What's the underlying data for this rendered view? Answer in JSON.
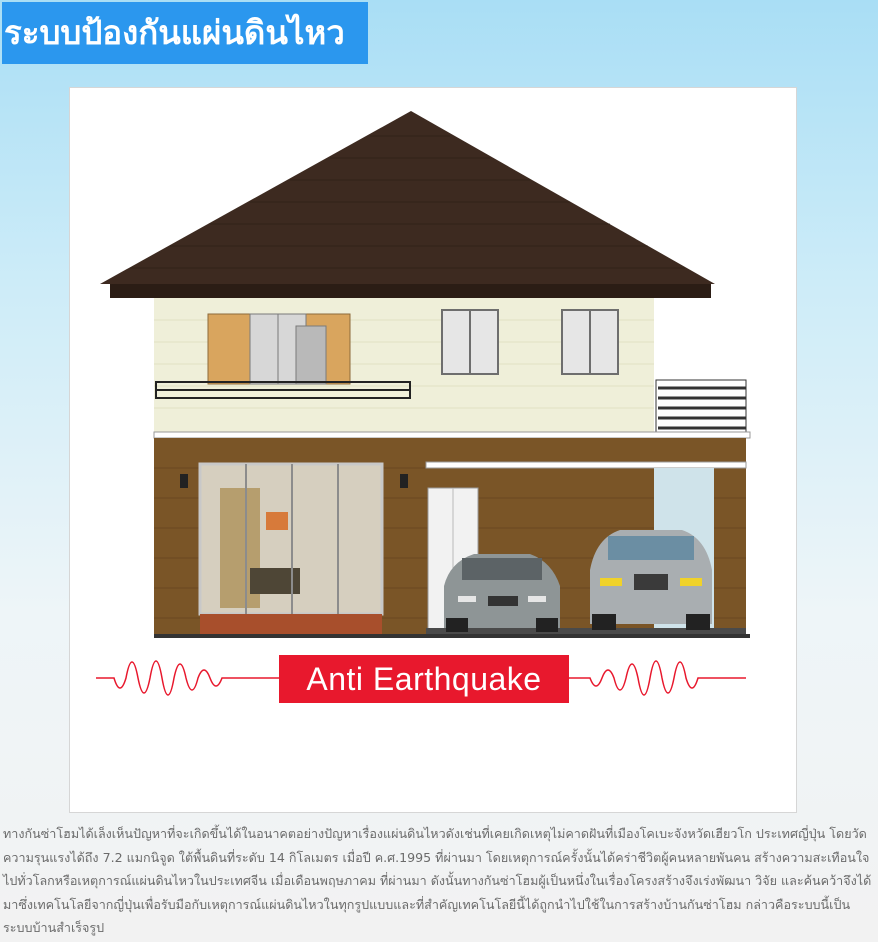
{
  "header": {
    "title": "ระบบป้องกันแผ่นดินไหว",
    "title_bg": "#2b97ee"
  },
  "hero": {
    "badge_label": "Anti Earthquake",
    "badge_color": "#e8182d",
    "wave_color": "#e8182d",
    "roof_color": "#3d2a20",
    "upper_wall_color": "#efefd9",
    "lower_wall_color": "#7a5527"
  },
  "article": {
    "body": "ทางกันซ่าโฮมได้เล็งเห็นปัญหาที่จะเกิดขึ้นได้ในอนาคตอย่างปัญหาเรื่องแผ่นดินไหวดังเช่นที่เคยเกิดเหตุไม่คาดฝันที่เมืองโคเบะจังหวัดเฮียวโก ประเทศญี่ปุ่น โดยวัดความรุนแรงได้ถึง 7.2 แมกนิจูด ใต้พื้นดินที่ระดับ 14 กิโลเมตร เมื่อปี ค.ศ.1995 ที่ผ่านมา โดยเหตุการณ์ครั้งนั้นได้คร่าชีวิตผู้คนหลายพันคน สร้างความสะเทือนใจไปทั่วโลกหรือเหตุการณ์แผ่นดินไหวในประเทศจีน เมื่อเดือนพฤษภาคม ที่ผ่านมา ดังนั้นทางกันซ่าโฮมผู้เป็นหนึ่งในเรื่องโครงสร้างจึงเร่งพัฒนา วิจัย และค้นคว้าจึงได้มาซึ่งเทคโนโลยีจากญี่ปุ่นเพื่อรับมือกับเหตุการณ์แผ่นดินไหวในทุกรูปแบบและที่สำคัญเทคโนโลยีนี้ได้ถูกนำไปใช้ในการสร้างบ้านกันซ่าโฮม กล่าวคือระบบนี้เป็นระบบบ้านสำเร็จรูป"
  }
}
